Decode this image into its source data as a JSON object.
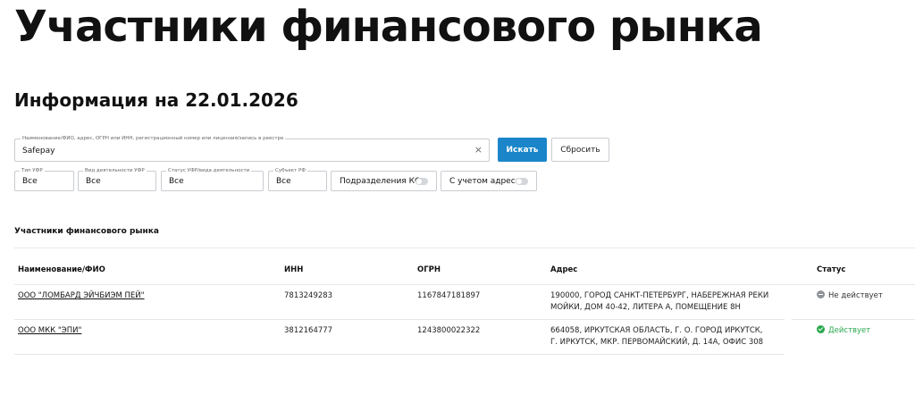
{
  "page": {
    "title": "Участники финансового рынка",
    "info_date": "Информация на 22.01.2026"
  },
  "search": {
    "label": "Наименование/ФИО, адрес, ОГРН или ИНН, регистрационный номер или лицензия/запись в реестре",
    "value": "Safepay",
    "clear_icon": "×",
    "search_button": "Искать",
    "reset_button": "Сбросить"
  },
  "filters": [
    {
      "label": "Тип УФР",
      "value": "Все"
    },
    {
      "label": "Вид деятельности УФР",
      "value": "Все"
    },
    {
      "label": "Статус УФР/вида деятельности",
      "value": "Все"
    },
    {
      "label": "Субъект РФ",
      "value": "Все"
    }
  ],
  "toggles": [
    {
      "label": "Подразделения КО",
      "on": false
    },
    {
      "label": "С учетом адреса",
      "on": false
    }
  ],
  "results": {
    "section_title": "Участники финансового рынка",
    "columns": [
      "Наименование/ФИО",
      "ИНН",
      "ОГРН",
      "Адрес",
      "Статус"
    ],
    "rows": [
      {
        "name": "ООО \"ЛОМБАРД ЭЙЧБИЭМ ПЕЙ\"",
        "inn": "7813249283",
        "ogrn": "1167847181897",
        "address_line1": "190000, ГОРОД САНКТ-ПЕТЕРБУРГ, НАБЕРЕЖНАЯ РЕКИ",
        "address_line2": "МОЙКИ, ДОМ 40-42, ЛИТЕРА А, ПОМЕЩЕНИЕ 8Н",
        "status": "Не действует",
        "status_color": "#8f9399"
      },
      {
        "name": "ООО МКК \"ЭПИ\"",
        "inn": "3812164777",
        "ogrn": "1243800022322",
        "address_line1": "664058, ИРКУТСКАЯ ОБЛАСТЬ, Г. О. ГОРОД ИРКУТСК,",
        "address_line2": "Г. ИРКУТСК, МКР. ПЕРВОМАЙСКИЙ, Д. 14А, ОФИС 308",
        "status": "Действует",
        "status_color": "#2aa84f"
      }
    ]
  },
  "colors": {
    "accent": "#1a86c9",
    "border": "#c9ccd1"
  }
}
